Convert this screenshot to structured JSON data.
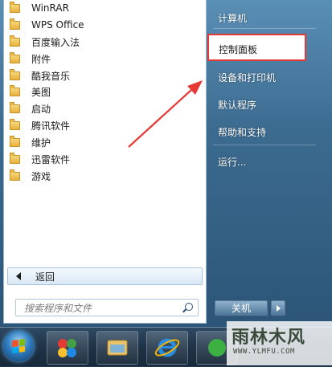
{
  "programs": [
    "WinRAR",
    "WPS Office",
    "百度输入法",
    "附件",
    "酷我音乐",
    "美图",
    "启动",
    "腾讯软件",
    "维护",
    "迅雷软件",
    "游戏"
  ],
  "back_label": "返回",
  "search_placeholder": "搜索程序和文件",
  "right_menu": {
    "computer": "计算机",
    "control_panel": "控制面板",
    "devices_printers": "设备和打印机",
    "default_programs": "默认程序",
    "help_support": "帮助和支持",
    "run": "运行..."
  },
  "shutdown_label": "关机",
  "watermark": {
    "main": "雨林木风",
    "sub": "WWW.YLMFU.COM"
  },
  "colors": {
    "highlight_border": "#e53935",
    "annotation_arrow": "#e53935"
  }
}
